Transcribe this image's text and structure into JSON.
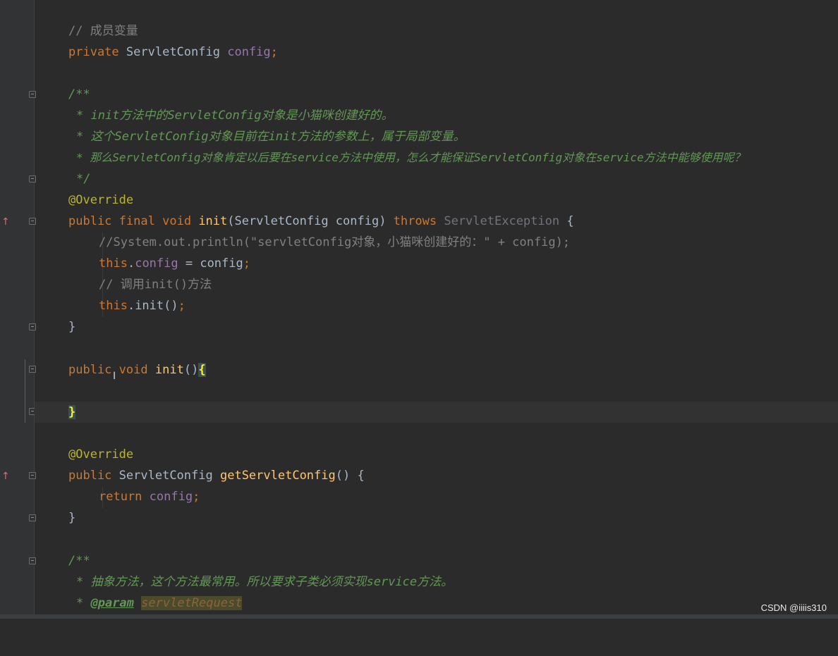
{
  "editor": {
    "comment_member": "// 成员变量",
    "kw_private": "private",
    "type_servletconfig": "ServletConfig",
    "field_config": "config",
    "semi": ";",
    "doc_open": "/**",
    "doc1_pre": "* ",
    "doc1_text": "init方法中的ServletConfig对象是小猫咪创建好的。",
    "doc2_text": "这个ServletConfig对象目前在init方法的参数上，属于局部变量。",
    "doc3_text": "那么ServletConfig对象肯定以后要在service方法中使用，怎么才能保证ServletConfig对象在service方法中能够使用呢？",
    "doc_close": "*/",
    "annotation_override": "@Override",
    "kw_public": "public",
    "kw_final": "final",
    "kw_void": "void",
    "fn_init": "init",
    "init_params": "(ServletConfig config) ",
    "kw_throws": "throws",
    "exc_name": "ServletException",
    "open_brace": " {",
    "commented_println": "//System.out.println(\"servletConfig对象，小猫咪创建好的：\" + config);",
    "kw_this": "this",
    "assign_rest": " = config",
    "comment_call_init": "// 调用init()方法",
    "this_init_call": ".init()",
    "close_brace": "}",
    "empty_parens": "()",
    "fn_get": "getServletConfig",
    "get_parens": "() {",
    "kw_return": "return",
    "doc_abstract": "抽象方法，这个方法最常用。所以要求子类必须实现service方法。",
    "doc_param_tag": "@param",
    "doc_param_name": "servletRequest",
    "dot": "."
  },
  "watermark": "CSDN @iiiis310"
}
